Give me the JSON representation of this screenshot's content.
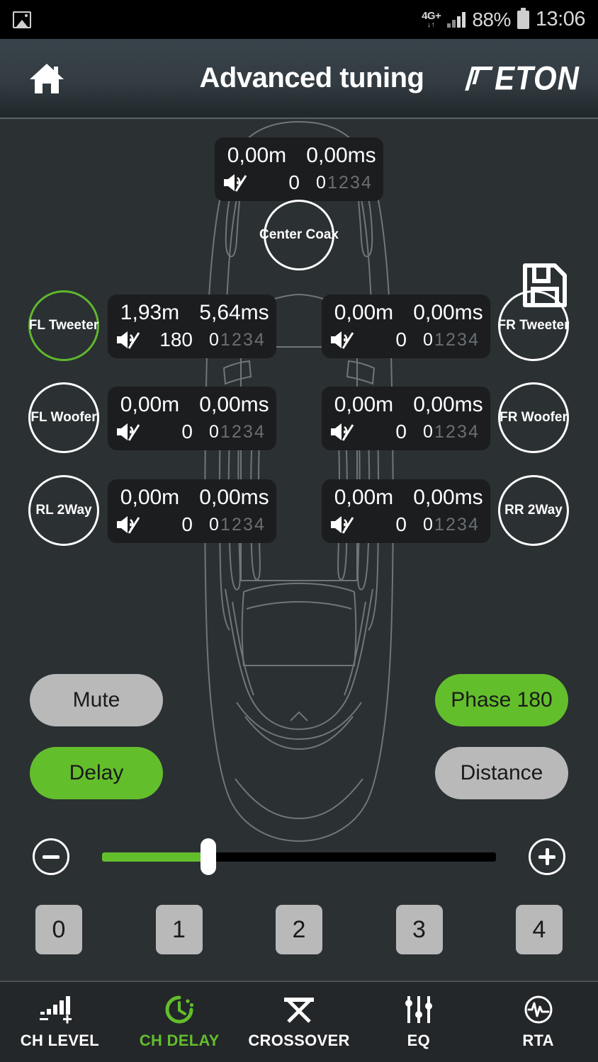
{
  "status_bar": {
    "gallery_icon": "image-icon",
    "network": "4G+",
    "network_sub": "↓↑",
    "signal_icon": "signal-bars-icon",
    "battery_percent": "88%",
    "battery_icon": "battery-icon",
    "time": "13:06"
  },
  "header": {
    "home_icon": "home-icon",
    "title": "Advanced tuning",
    "brand": "ETON",
    "brand_mark": "eton-logo-mark"
  },
  "main": {
    "save_icon": "floppy-disk-save-icon",
    "car_outline": "car-top-view-outline",
    "mute_icon": "speaker-muted-icon",
    "phase_steps": [
      "0",
      "1",
      "2",
      "3",
      "4"
    ],
    "channels": [
      {
        "id": "center-coax",
        "label": "Center Coax",
        "distance": "0,00m",
        "delay": "0,00ms",
        "phase": "0",
        "selected_step": 0,
        "active": false,
        "muted": true
      },
      {
        "id": "fl-tweeter",
        "label": "FL Tweeter",
        "distance": "1,93m",
        "delay": "5,64ms",
        "phase": "180",
        "selected_step": 0,
        "active": true,
        "muted": true
      },
      {
        "id": "fr-tweeter",
        "label": "FR Tweeter",
        "distance": "0,00m",
        "delay": "0,00ms",
        "phase": "0",
        "selected_step": 0,
        "active": false,
        "muted": true
      },
      {
        "id": "fl-woofer",
        "label": "FL Woofer",
        "distance": "0,00m",
        "delay": "0,00ms",
        "phase": "0",
        "selected_step": 0,
        "active": false,
        "muted": true
      },
      {
        "id": "fr-woofer",
        "label": "FR Woofer",
        "distance": "0,00m",
        "delay": "0,00ms",
        "phase": "0",
        "selected_step": 0,
        "active": false,
        "muted": true
      },
      {
        "id": "rl-2way",
        "label": "RL 2Way",
        "distance": "0,00m",
        "delay": "0,00ms",
        "phase": "0",
        "selected_step": 0,
        "active": false,
        "muted": true
      },
      {
        "id": "rr-2way",
        "label": "RR 2Way",
        "distance": "0,00m",
        "delay": "0,00ms",
        "phase": "0",
        "selected_step": 0,
        "active": false,
        "muted": true
      }
    ],
    "toggles": {
      "mute": {
        "label": "Mute",
        "on": false
      },
      "phase": {
        "label": "Phase 180",
        "on": true
      },
      "delay": {
        "label": "Delay",
        "on": true
      },
      "distance": {
        "label": "Distance",
        "on": false
      }
    },
    "slider": {
      "minus_icon": "minus-circle-icon",
      "plus_icon": "plus-circle-icon",
      "fill_percent": 27
    },
    "step_buttons": [
      "0",
      "1",
      "2",
      "3",
      "4"
    ]
  },
  "nav": {
    "items": [
      {
        "label": "CH LEVEL",
        "icon": "bars-level-icon",
        "active": false
      },
      {
        "label": "CH DELAY",
        "icon": "clock-delay-icon",
        "active": true
      },
      {
        "label": "CROSSOVER",
        "icon": "crossover-icon",
        "active": false
      },
      {
        "label": "EQ",
        "icon": "equalizer-sliders-icon",
        "active": false
      },
      {
        "label": "RTA",
        "icon": "waveform-circle-icon",
        "active": false
      }
    ]
  },
  "colors": {
    "accent_green": "#63be2c",
    "background": "#2b3033",
    "panel": "#1b1d1f",
    "pill_off": "#b9b9b9"
  }
}
